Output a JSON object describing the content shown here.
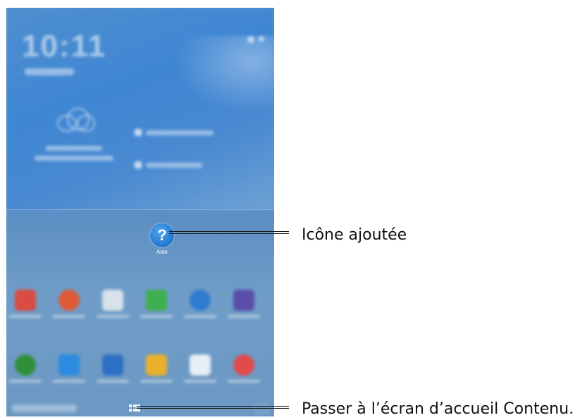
{
  "screen": {
    "clock": "10:11",
    "added_icon": {
      "icon": "help-question-icon",
      "glyph": "?",
      "label": "Aide",
      "color": "#2b7fd6"
    },
    "dock_apps": [
      {
        "icon": "calendar-icon",
        "color": "#d94b43"
      },
      {
        "icon": "chrome-icon",
        "color": "#e05a35"
      },
      {
        "icon": "play-store-icon",
        "color": "#d9e2ea"
      },
      {
        "icon": "phone-icon",
        "color": "#3fb04d"
      },
      {
        "icon": "internet-globe-icon",
        "color": "#2e7bd0"
      },
      {
        "icon": "gallery-icon",
        "color": "#5a4ea8"
      },
      {
        "icon": "earth-icon",
        "color": "#2f8f3a"
      },
      {
        "icon": "photo-icon",
        "color": "#2a8be0"
      },
      {
        "icon": "contacts-icon",
        "color": "#2d6fc4"
      },
      {
        "icon": "my-files-icon",
        "color": "#e9b12a"
      },
      {
        "icon": "heart-app-icon",
        "color": "#e7eef5"
      },
      {
        "icon": "game-icon",
        "color": "#e14a4a"
      }
    ]
  },
  "callouts": {
    "added_icon": "Icône ajoutée",
    "switch_home": "Passer à l’écran d’accueil Contenu."
  }
}
